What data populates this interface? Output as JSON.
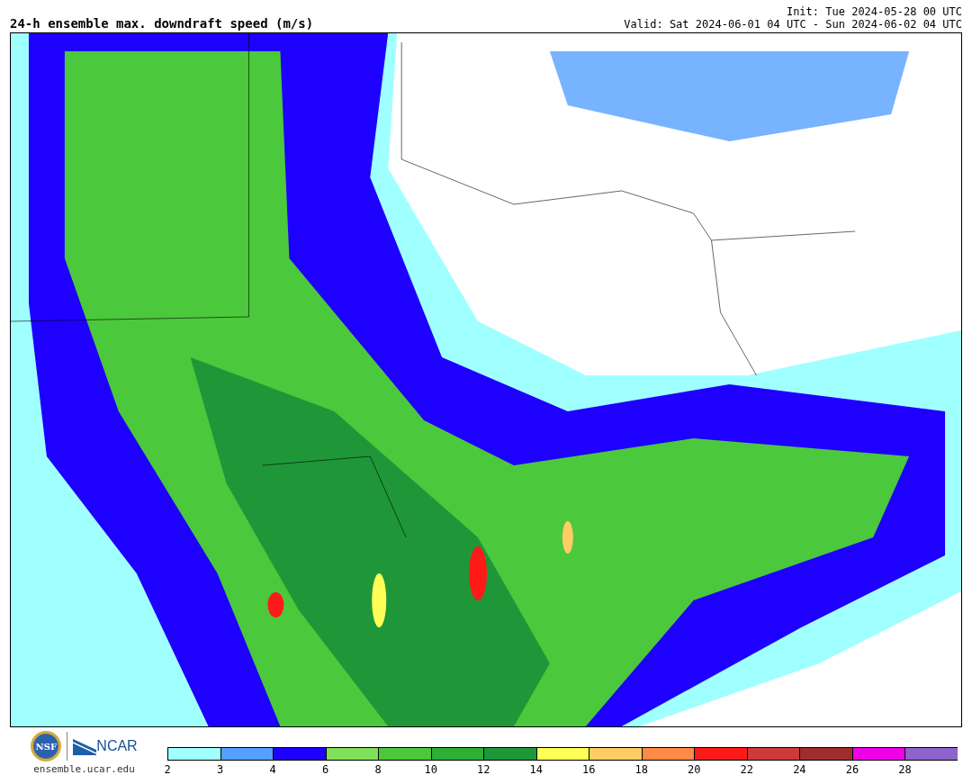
{
  "title": "24-h ensemble max. downdraft speed (m/s)",
  "init": "Init: Tue 2024-05-28 00 UTC",
  "valid": "Valid: Sat 2024-06-01 04 UTC - Sun 2024-06-02 04 UTC",
  "logos": {
    "nsf": "NSF",
    "ncar": "NCAR",
    "url": "ensemble.ucar.edu"
  },
  "colorbar": [
    {
      "color": "#a0ffff",
      "label": "2"
    },
    {
      "color": "#55a0ff",
      "label": "3"
    },
    {
      "color": "#1e00ff",
      "label": "4"
    },
    {
      "color": "#7fe05a",
      "label": "6"
    },
    {
      "color": "#4cc83c",
      "label": "8"
    },
    {
      "color": "#2eb036",
      "label": "10"
    },
    {
      "color": "#1f9738",
      "label": "12"
    },
    {
      "color": "#ffff55",
      "label": "14"
    },
    {
      "color": "#ffcc66",
      "label": "16"
    },
    {
      "color": "#ff8a45",
      "label": "18"
    },
    {
      "color": "#ff1a1a",
      "label": "20"
    },
    {
      "color": "#cc3a3a",
      "label": "22"
    },
    {
      "color": "#a02d2d",
      "label": "24"
    },
    {
      "color": "#f000e8",
      "label": "26"
    },
    {
      "color": "#8e63cc",
      "label": "28"
    }
  ]
}
